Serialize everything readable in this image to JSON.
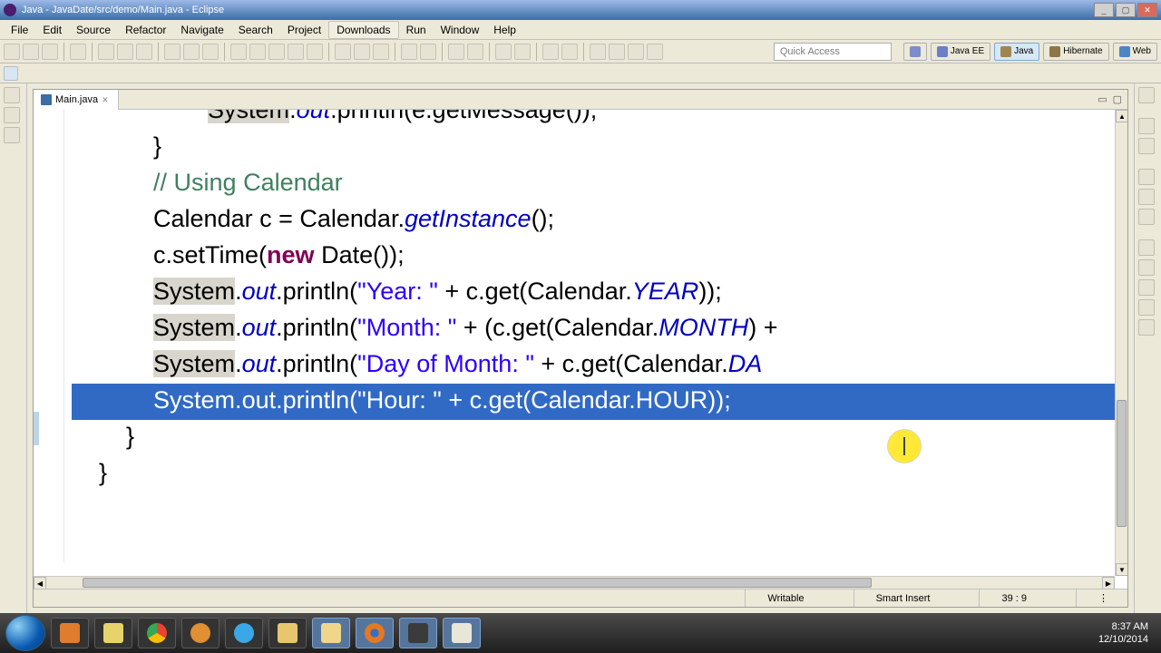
{
  "window": {
    "title": "Java - JavaDate/src/demo/Main.java - Eclipse"
  },
  "menubar": [
    "File",
    "Edit",
    "Source",
    "Refactor",
    "Navigate",
    "Search",
    "Project",
    "Downloads",
    "Run",
    "Window",
    "Help"
  ],
  "toolbar": {
    "quick_access": "Quick Access",
    "perspectives": [
      {
        "label": "Java EE",
        "active": false
      },
      {
        "label": "Java",
        "active": true
      },
      {
        "label": "Hibernate",
        "active": false
      },
      {
        "label": "Web",
        "active": false
      }
    ]
  },
  "editor": {
    "tab_name": "Main.java",
    "code_lines": [
      {
        "indent": 5,
        "tokens": [
          {
            "t": "System",
            "c": "grey-hl"
          },
          {
            "t": ".",
            "c": ""
          },
          {
            "t": "out",
            "c": "fld"
          },
          {
            "t": ".println(e.getMessage());",
            "c": ""
          }
        ]
      },
      {
        "indent": 3,
        "tokens": [
          {
            "t": "}",
            "c": ""
          }
        ]
      },
      {
        "indent": 0,
        "tokens": []
      },
      {
        "indent": 3,
        "tokens": [
          {
            "t": "// Using Calendar",
            "c": "cmt"
          }
        ]
      },
      {
        "indent": 3,
        "tokens": [
          {
            "t": "Calendar c = Calendar.",
            "c": ""
          },
          {
            "t": "getInstance",
            "c": "sta"
          },
          {
            "t": "();",
            "c": ""
          }
        ]
      },
      {
        "indent": 3,
        "tokens": [
          {
            "t": "c.setTime(",
            "c": ""
          },
          {
            "t": "new",
            "c": "kw"
          },
          {
            "t": " Date());",
            "c": ""
          }
        ]
      },
      {
        "indent": 3,
        "tokens": [
          {
            "t": "System",
            "c": "grey-hl"
          },
          {
            "t": ".",
            "c": ""
          },
          {
            "t": "out",
            "c": "fld"
          },
          {
            "t": ".println(",
            "c": ""
          },
          {
            "t": "\"Year: \"",
            "c": "str"
          },
          {
            "t": " + c.get(Calendar.",
            "c": ""
          },
          {
            "t": "YEAR",
            "c": "sta"
          },
          {
            "t": "));",
            "c": ""
          }
        ]
      },
      {
        "indent": 3,
        "tokens": [
          {
            "t": "System",
            "c": "grey-hl"
          },
          {
            "t": ".",
            "c": ""
          },
          {
            "t": "out",
            "c": "fld"
          },
          {
            "t": ".println(",
            "c": ""
          },
          {
            "t": "\"Month: \"",
            "c": "str"
          },
          {
            "t": " + (c.get(Calendar.",
            "c": ""
          },
          {
            "t": "MONTH",
            "c": "sta"
          },
          {
            "t": ") +",
            "c": ""
          }
        ]
      },
      {
        "indent": 3,
        "tokens": [
          {
            "t": "System",
            "c": "grey-hl"
          },
          {
            "t": ".",
            "c": ""
          },
          {
            "t": "out",
            "c": "fld"
          },
          {
            "t": ".println(",
            "c": ""
          },
          {
            "t": "\"Day of Month: \"",
            "c": "str"
          },
          {
            "t": " + c.get(Calendar.",
            "c": ""
          },
          {
            "t": "DA",
            "c": "sta"
          }
        ]
      },
      {
        "indent": 3,
        "sel": true,
        "tokens": [
          {
            "t": "System.",
            "c": ""
          },
          {
            "t": "out",
            "c": "fld"
          },
          {
            "t": ".println(",
            "c": ""
          },
          {
            "t": "\"Hour: \"",
            "c": "str"
          },
          {
            "t": " + c.get(Calendar.",
            "c": ""
          },
          {
            "t": "HOUR",
            "c": "sta"
          },
          {
            "t": "));",
            "c": ""
          }
        ]
      },
      {
        "indent": 0,
        "tokens": []
      },
      {
        "indent": 2,
        "tokens": [
          {
            "t": "}",
            "c": ""
          }
        ]
      },
      {
        "indent": 0,
        "tokens": []
      },
      {
        "indent": 1,
        "tokens": [
          {
            "t": "}",
            "c": ""
          }
        ]
      }
    ]
  },
  "status": {
    "writable": "Writable",
    "insert": "Smart Insert",
    "cursor": "39 : 9"
  },
  "taskbar": {
    "time": "8:37 AM",
    "date": "12/10/2014",
    "icons": [
      "media",
      "sticky",
      "chrome",
      "live",
      "skype",
      "explorer",
      "folder",
      "firefox",
      "idea",
      "notepad"
    ]
  }
}
